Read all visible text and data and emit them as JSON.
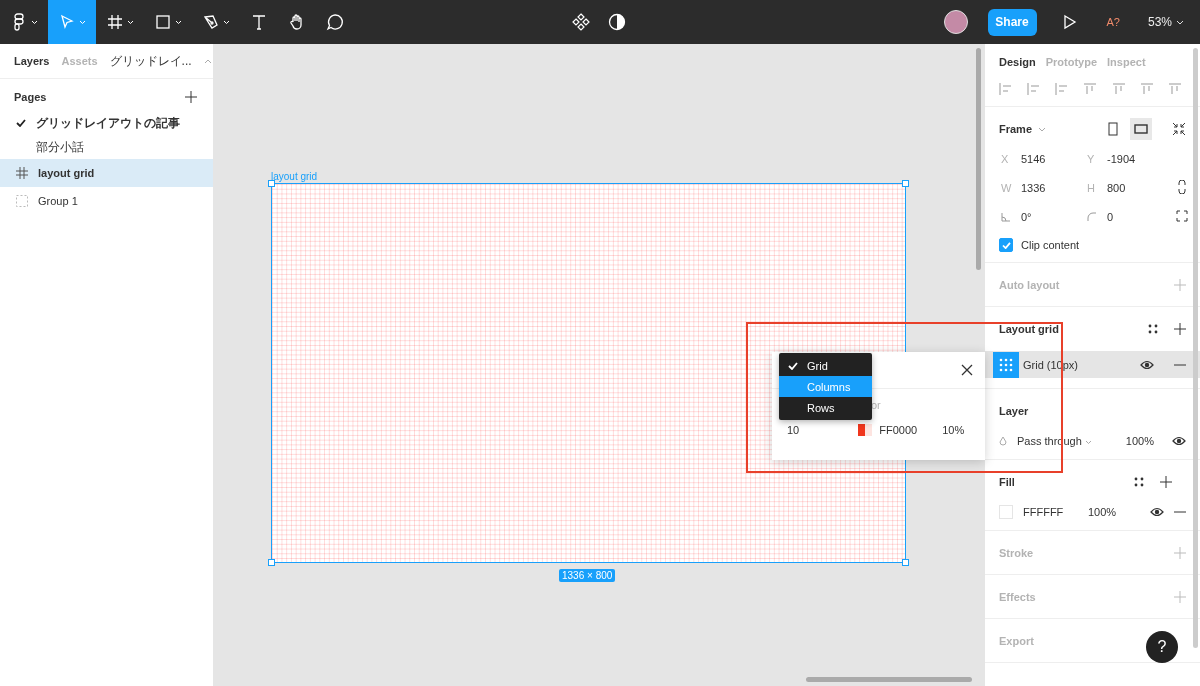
{
  "toolbar": {
    "tools": [
      {
        "kind": "logo",
        "selected": false,
        "menu": true
      },
      {
        "kind": "move",
        "selected": true,
        "menu": true
      },
      {
        "kind": "frame",
        "selected": false,
        "menu": true
      },
      {
        "kind": "rect",
        "selected": false,
        "menu": true
      },
      {
        "kind": "pen",
        "selected": false,
        "menu": true
      },
      {
        "kind": "text",
        "selected": false,
        "menu": false
      },
      {
        "kind": "hand",
        "selected": false,
        "menu": false
      },
      {
        "kind": "comment",
        "selected": false,
        "menu": false
      }
    ],
    "share": "Share",
    "font_warning": "A?",
    "zoom": "53%"
  },
  "left_panel": {
    "tabs": [
      {
        "label": "Layers",
        "selected": true
      },
      {
        "label": "Assets",
        "selected": false
      }
    ],
    "page_selector": "グリッドレイ...",
    "pages_title": "Pages",
    "pages": [
      {
        "label": "グリッドレイアウトの記事",
        "selected": true
      },
      {
        "label": "部分小話",
        "selected": false
      }
    ],
    "layers": [
      {
        "name": "layout grid",
        "kind": "frame",
        "selected": true
      },
      {
        "name": "Group 1",
        "kind": "group",
        "selected": false
      }
    ]
  },
  "canvas": {
    "frame_label": "layout grid",
    "size_badge": "1336 × 800",
    "grid_popover": {
      "size": "10",
      "label_fragment": "or",
      "hex": "FF0000",
      "opacity": "10%"
    },
    "type_menu": [
      {
        "label": "Grid",
        "checked": true,
        "selected": false
      },
      {
        "label": "Columns",
        "checked": false,
        "selected": true
      },
      {
        "label": "Rows",
        "checked": false,
        "selected": false
      }
    ]
  },
  "right_panel": {
    "tabs": [
      {
        "label": "Design",
        "selected": true
      },
      {
        "label": "Prototype",
        "selected": false
      },
      {
        "label": "Inspect",
        "selected": false
      }
    ],
    "frame": {
      "title": "Frame",
      "fields": [
        {
          "kind": "letter",
          "label": "X",
          "value": "5146"
        },
        {
          "kind": "letter",
          "label": "Y",
          "value": "-1904"
        },
        {
          "kind": "letter",
          "label": "W",
          "value": "1336"
        },
        {
          "kind": "letter",
          "label": "H",
          "value": "800"
        },
        {
          "kind": "rotation",
          "value": "0°"
        },
        {
          "kind": "radius",
          "value": "0"
        }
      ],
      "clip": {
        "label": "Clip content",
        "checked": true
      }
    },
    "auto_layout": "Auto layout",
    "layout_grid": {
      "title": "Layout grid",
      "item": "Grid (10px)"
    },
    "layer": {
      "title": "Layer",
      "blend": "Pass through",
      "opacity": "100%"
    },
    "fill": {
      "title": "Fill",
      "hex": "FFFFFF",
      "opacity": "100%"
    },
    "stroke": "Stroke",
    "effects": "Effects",
    "export": "Export"
  },
  "help": "?"
}
